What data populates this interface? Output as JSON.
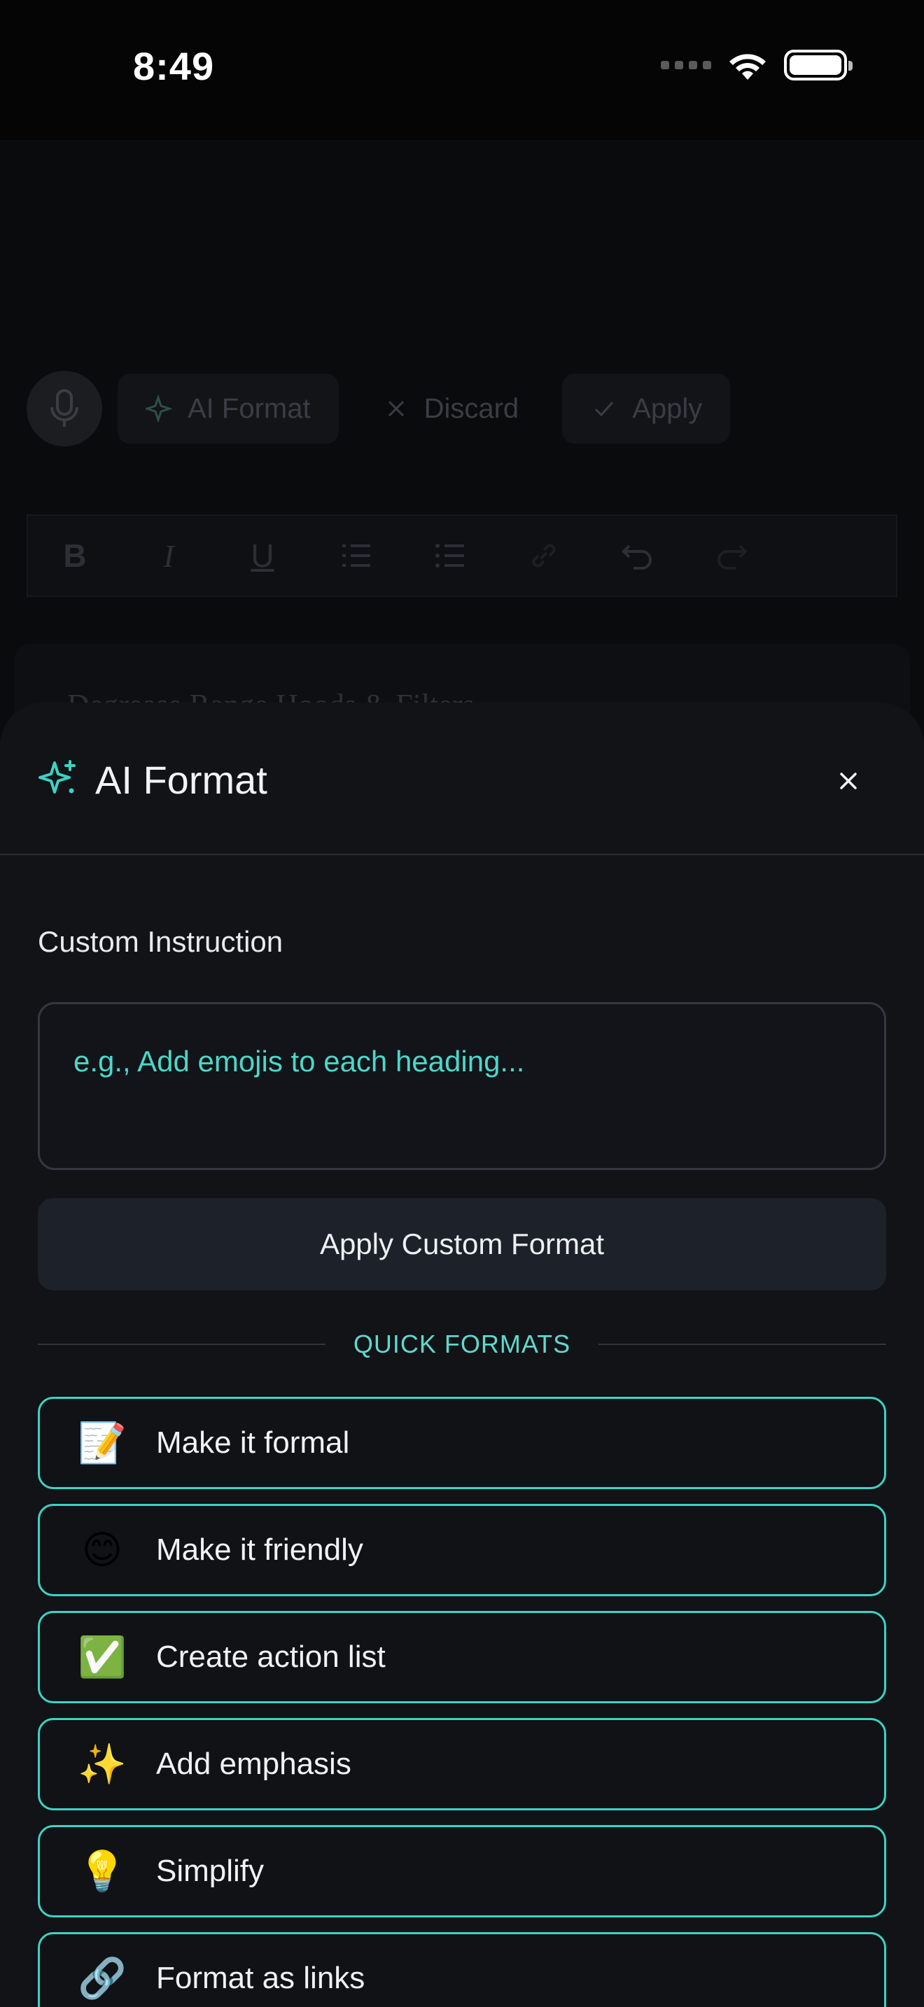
{
  "status_bar": {
    "time": "8:49"
  },
  "editor": {
    "toolbar": {
      "ai_format_label": "AI Format",
      "discard_label": "Discard",
      "apply_label": "Apply"
    },
    "document_text": "Degrease Range Hoods & Filters"
  },
  "sheet": {
    "title": "AI Format",
    "custom_instruction_label": "Custom Instruction",
    "instruction_placeholder": "e.g., Add emojis to each heading...",
    "instruction_value": "",
    "apply_custom_label": "Apply Custom Format",
    "quick_formats_label": "QUICK FORMATS",
    "quick_formats": [
      {
        "icon": "📝",
        "label": "Make it formal"
      },
      {
        "icon": "😊",
        "label": "Make it friendly"
      },
      {
        "icon": "✅",
        "label": "Create action list"
      },
      {
        "icon": "✨",
        "label": "Add emphasis"
      },
      {
        "icon": "💡",
        "label": "Simplify"
      },
      {
        "icon": "🔗",
        "label": "Format as links"
      }
    ]
  },
  "colors": {
    "accent": "#3cd3c4",
    "sheet_bg": "#111317",
    "button_bg": "#1d2129"
  }
}
